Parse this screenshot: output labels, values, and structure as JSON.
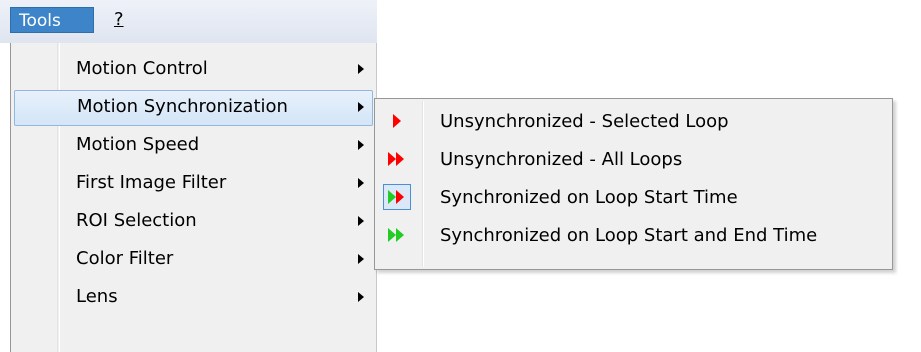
{
  "menubar": {
    "tools_label": "Tools",
    "help_label": "?"
  },
  "tools_menu": {
    "items": [
      {
        "label": "Motion Control",
        "has_submenu": true
      },
      {
        "label": "Motion Synchronization",
        "has_submenu": true,
        "highlighted": true
      },
      {
        "label": "Motion Speed",
        "has_submenu": true
      },
      {
        "label": "First Image Filter",
        "has_submenu": true
      },
      {
        "label": "ROI Selection",
        "has_submenu": true
      },
      {
        "label": "Color Filter",
        "has_submenu": true
      },
      {
        "label": "Lens",
        "has_submenu": true
      }
    ]
  },
  "sync_submenu": {
    "items": [
      {
        "label": "Unsynchronized - Selected Loop",
        "icon": "single-red-play-icon"
      },
      {
        "label": "Unsynchronized - All Loops",
        "icon": "double-red-play-icon"
      },
      {
        "label": "Synchronized on Loop Start Time",
        "icon": "green-red-play-icon",
        "checked": true
      },
      {
        "label": "Synchronized on Loop Start and End Time",
        "icon": "double-green-play-icon"
      }
    ]
  },
  "colors": {
    "red": "#ff0000",
    "green": "#22cc22",
    "highlight_border": "#93b8dd",
    "menubar_selected": "#3d85c8"
  }
}
